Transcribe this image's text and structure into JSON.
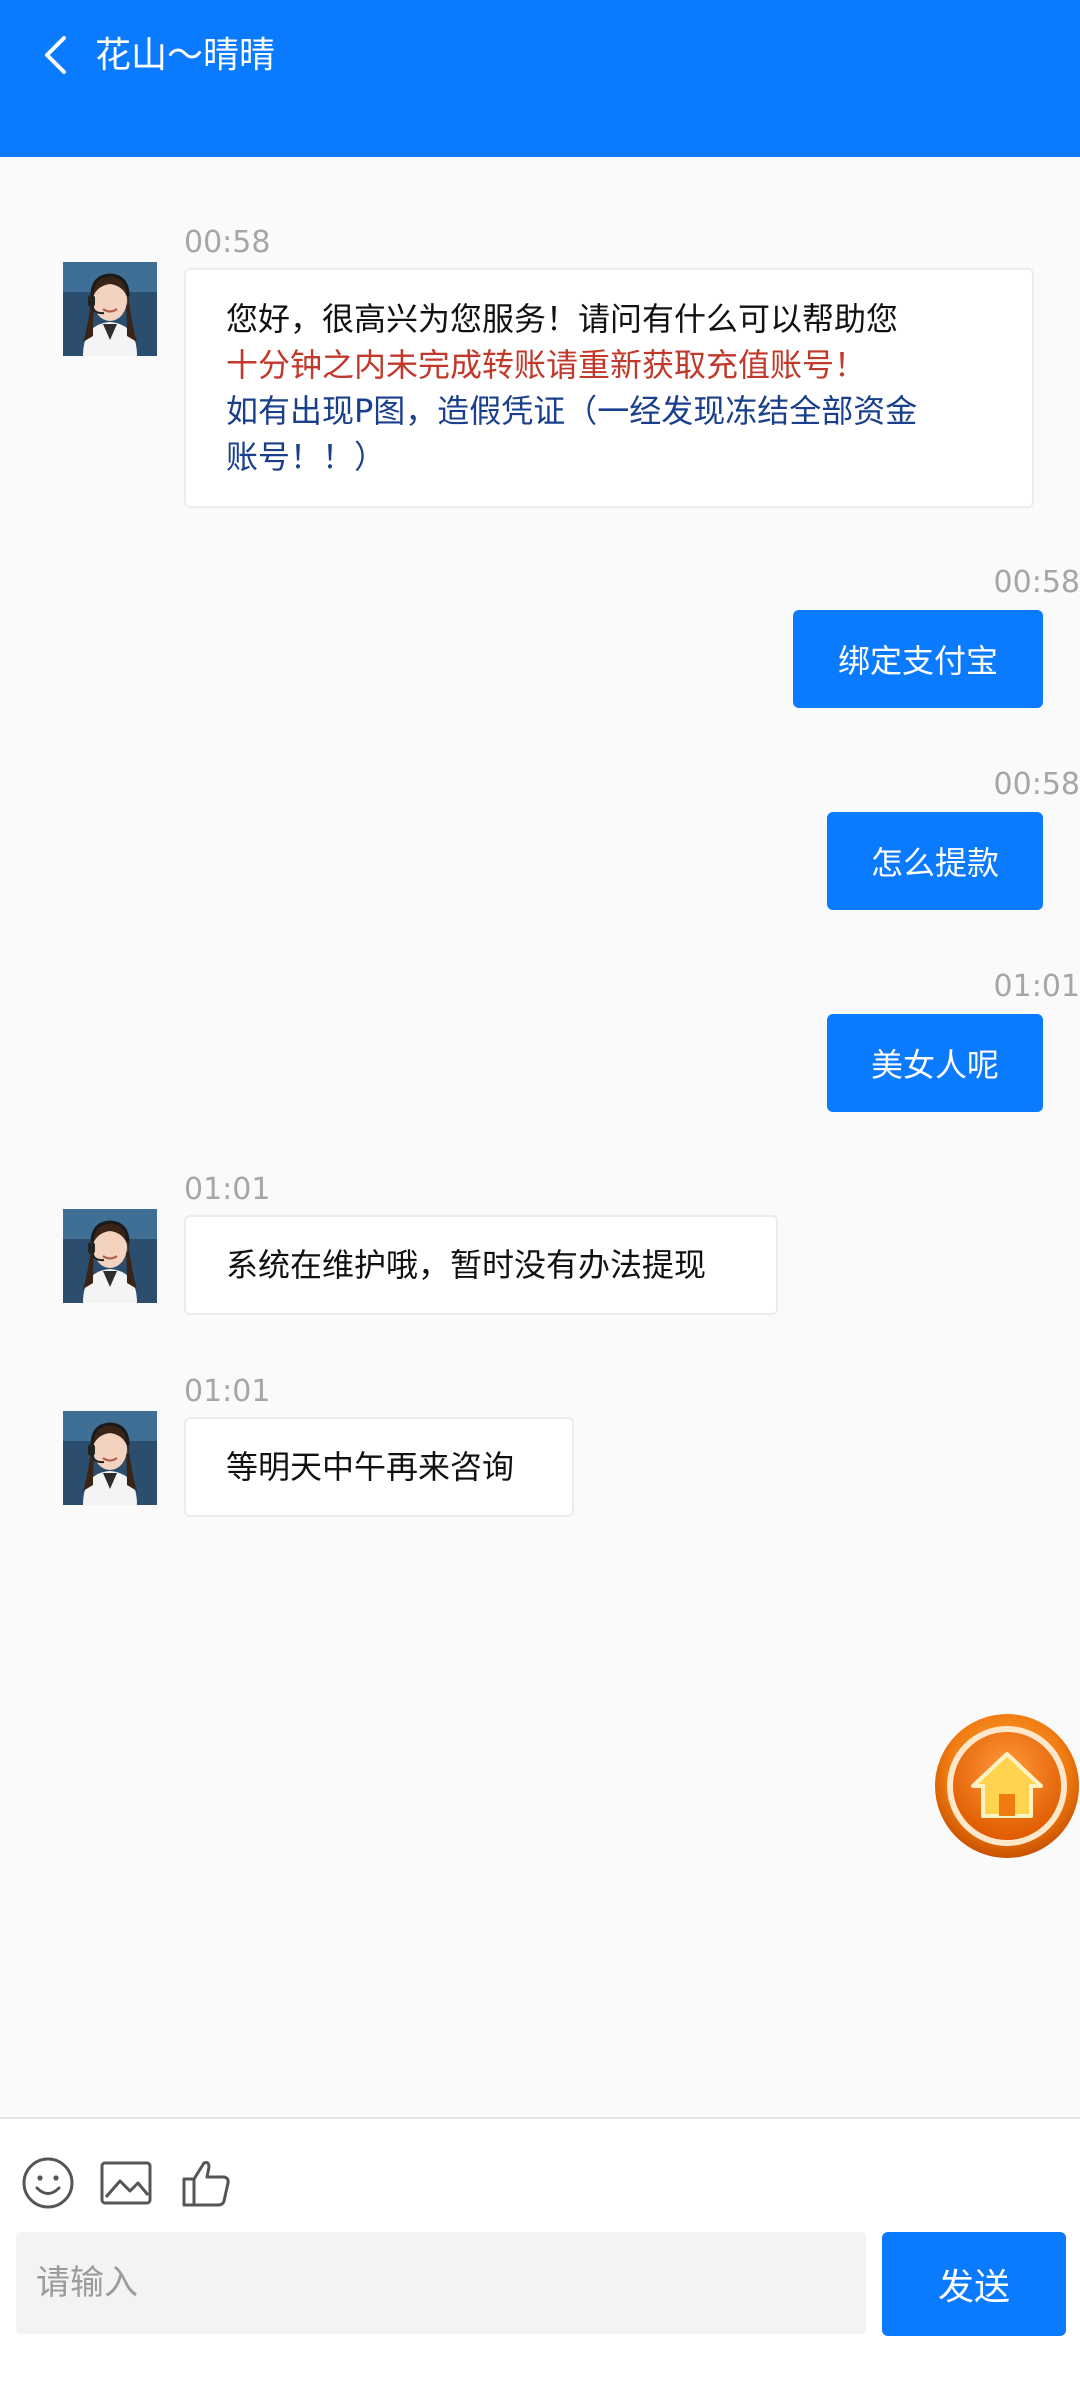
{
  "header": {
    "title": "花山～晴晴"
  },
  "messages": [
    {
      "time": "00:58",
      "lines": [
        "您好，很高兴为您服务！请问有什么可以帮助您",
        "十分钟之内未完成转账请重新获取充值账号！",
        "如有出现P图，造假凭证（一经发现冻结全部资金",
        "账号！！）"
      ]
    },
    {
      "time": "00:58",
      "text": "绑定支付宝"
    },
    {
      "time": "00:58",
      "text": "怎么提款"
    },
    {
      "time": "01:01",
      "text": "美女人呢"
    },
    {
      "time": "01:01",
      "text": "系统在维护哦，暂时没有办法提现"
    },
    {
      "time": "01:01",
      "text": "等明天中午再来咨询"
    }
  ],
  "colors": {
    "accent": "#0a7aff",
    "warning_red": "#c0392b",
    "notice_blue": "#1a3f8c"
  },
  "composer": {
    "placeholder": "请输入",
    "send_label": "发送",
    "tools": [
      "emoji-icon",
      "image-icon",
      "thumbs-up-icon"
    ]
  },
  "floating": {
    "icon": "home-icon"
  }
}
